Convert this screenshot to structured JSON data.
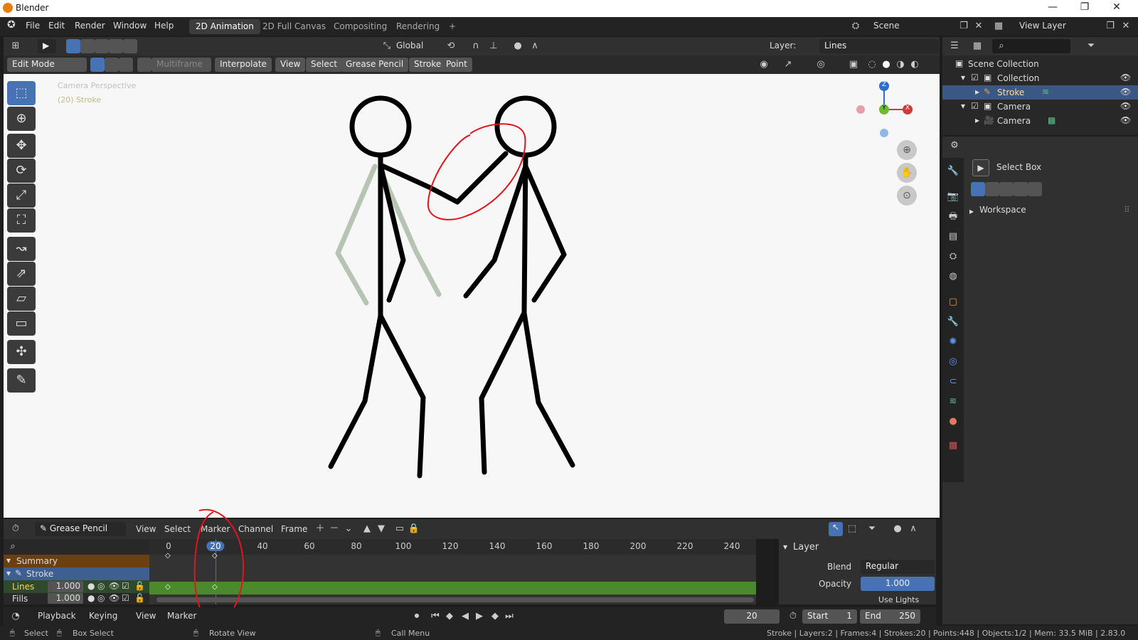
{
  "titlebar": {
    "title": "Blender"
  },
  "menu": {
    "items": [
      "File",
      "Edit",
      "Render",
      "Window",
      "Help"
    ]
  },
  "workspaces": {
    "tabs": [
      "2D Animation",
      "2D Full Canvas",
      "Compositing",
      "Rendering"
    ],
    "add": "+"
  },
  "scene": {
    "scene_label": "Scene",
    "view_layer_label": "View Layer"
  },
  "header": {
    "orientation": "Global",
    "layer_label": "Layer:",
    "layer_value": "Lines"
  },
  "toolbar2": {
    "mode": "Edit Mode",
    "multiframe": "Multiframe",
    "interpolate": "Interpolate",
    "view": "View",
    "select": "Select",
    "grease_pencil": "Grease Pencil",
    "stroke": "Stroke",
    "point": "Point"
  },
  "viewport": {
    "overlay_line1": "Camera Perspective",
    "overlay_line2": "(20) Stroke",
    "gizmo_x": "X",
    "gizmo_y": "Y",
    "gizmo_z": "Z"
  },
  "outliner": {
    "rows": [
      {
        "label": "Scene Collection"
      },
      {
        "label": "Collection"
      },
      {
        "label": "Stroke"
      },
      {
        "label": "Camera"
      },
      {
        "label": "Camera"
      }
    ]
  },
  "properties": {
    "tool_name": "Select Box",
    "workspace": "Workspace"
  },
  "timeline": {
    "editor": "Grease Pencil",
    "menus": [
      "View",
      "Select",
      "Marker",
      "Channel",
      "Frame"
    ],
    "ticks": [
      "0",
      "20",
      "40",
      "60",
      "80",
      "100",
      "120",
      "140",
      "160",
      "180",
      "200",
      "220",
      "240"
    ],
    "current_frame": "20",
    "channels": [
      {
        "name": "Summary"
      },
      {
        "name": "Stroke"
      },
      {
        "name": "Lines",
        "value": "1.000"
      },
      {
        "name": "Fills",
        "value": "1.000"
      }
    ]
  },
  "layer_panel": {
    "title": "Layer",
    "blend_label": "Blend",
    "blend_value": "Regular",
    "opacity_label": "Opacity",
    "opacity_value": "1.000",
    "use_lights": "Use Lights"
  },
  "playbar": {
    "playback": "Playback",
    "keying": "Keying",
    "view": "View",
    "marker": "Marker",
    "frame": "20",
    "start_label": "Start",
    "start_value": "1",
    "end_label": "End",
    "end_value": "250"
  },
  "status": {
    "select": "Select",
    "box_select": "Box Select",
    "rotate_view": "Rotate View",
    "call_menu": "Call Menu",
    "stats": "Stroke | Layers:2 | Frames:4 | Strokes:20 | Points:448 | Objects:1/2 | Mem: 33.5 MiB | 2.83.0"
  },
  "colors": {
    "accent": "#4772b3",
    "annotation_red": "#e0161c",
    "keyframe_green": "#4a8a2c",
    "summary_orange": "#7a4a14"
  }
}
